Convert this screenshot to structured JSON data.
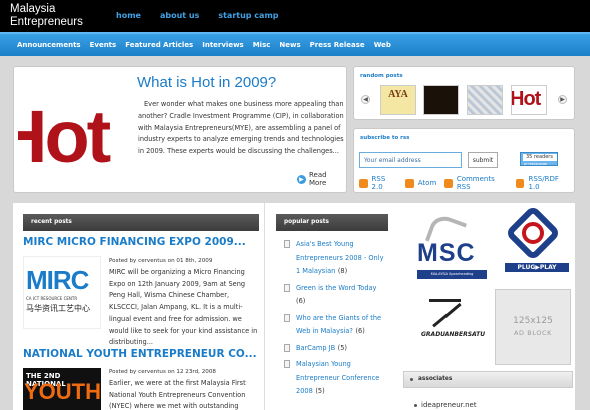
{
  "site": {
    "brand_line1": "Malaysia",
    "brand_line2": "Entrepreneurs",
    "top_nav": [
      "home",
      "about us",
      "startup camp"
    ]
  },
  "menu": [
    "Announcements",
    "Events",
    "Featured Articles",
    "Interviews",
    "Misc",
    "News",
    "Press Release",
    "Web"
  ],
  "featured": {
    "image_text": "Hot in",
    "title": "What is Hot in 2009?",
    "excerpt": "Ever wonder what makes one business more appealing than another? Cradle Investment Programme (CIP), in collaboration with Malaysia Entrepreneurs(MYE), are assembling a panel of industry experts to analyze emerging trends and technologies in 2009. These experts would be discussing the challenges...",
    "read_more": "Read More"
  },
  "random_posts": {
    "title": "random posts",
    "prev": "◀",
    "next": "▶",
    "thumb1_text": "AYA",
    "thumb4_text": "Hot"
  },
  "subscribe": {
    "title": "subscribe to rss",
    "email_placeholder": "Your email address",
    "button": "submit",
    "reader_count": "35 readers",
    "feed_by": "BY FEEDBURNER",
    "links": [
      "RSS 2.0",
      "Atom",
      "Comments RSS",
      "RSS/RDF 1.0"
    ]
  },
  "recent_posts": {
    "heading": "recent posts",
    "posts": [
      {
        "title": "MIRC MICRO FINANCING EXPO 2009...",
        "meta": "Posted by cerventus on 01 8th, 2009",
        "body": "MIRC will be organizing a Micro Financing Expo on 12th January 2009, 9am at Seng Peng Hall, Wisma Chinese Chamber, KLSCCCI, Jalan Ampang, KL. It is a multi-lingual event and free for admission. we would like to seek for your kind assistance in distributing...",
        "img_logo": "MIRC",
        "img_sub": "CA ICT RESOURCE CENTR",
        "img_chinese": "马华资讯工艺中心"
      },
      {
        "title": "NATIONAL YOUTH ENTREPRENEUR CO...",
        "meta": "Posted by cerventus on 12 23rd, 2008",
        "body": "Earlier, we were at the first Malaysia First National Youth Entrepreneurs Convention (NYEC) where we met with outstanding",
        "img_top": "THE 2ND NATIONAL",
        "img_big": "YOUTH"
      }
    ]
  },
  "popular_posts": {
    "heading": "popular posts",
    "items": [
      {
        "title": "Asia's Best Young Entrepreneurs 2008 - Only 1 Malaysian",
        "count": "(8)"
      },
      {
        "title": "Green is the Word Today",
        "count": "(6)"
      },
      {
        "title": "Who are the Giants of the Web in Malaysia?",
        "count": "(6)"
      },
      {
        "title": "BarCamp JB",
        "count": "(5)"
      },
      {
        "title": "Malaysian Young Entrepreneur Conference 2008",
        "count": "(5)"
      }
    ]
  },
  "sponsors": {
    "msc": "MSC",
    "msc_tag": "MALAYSIA Spearheading Transformation",
    "plugplay": "PLUG▶PLAY",
    "graduan": "GRADUANBERSATU",
    "ad_size": "125x125",
    "ad_label": "AD BLOCK"
  },
  "associates": {
    "heading": "associates",
    "links": [
      "ideapreneur.net"
    ]
  },
  "colors": {
    "accent_blue": "#1a7cc8",
    "menu_blue": "#2a8fd8",
    "hot_red": "#b0121a",
    "rss_orange": "#f08a1c"
  }
}
